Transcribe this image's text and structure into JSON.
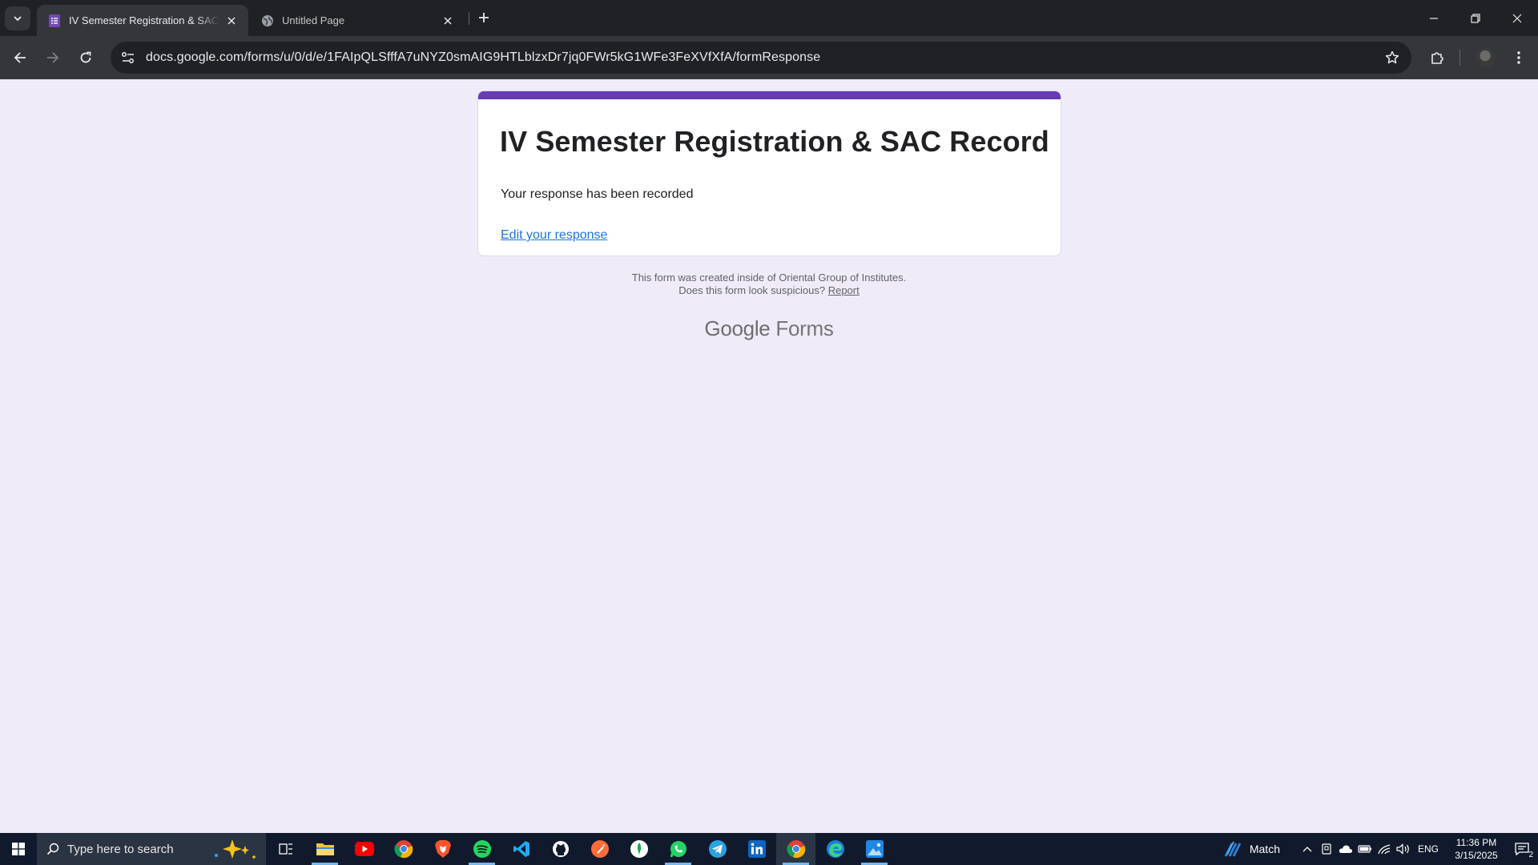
{
  "browser": {
    "tabs": [
      {
        "label": "IV Semester Registration & SAC Record",
        "active": true,
        "favicon": "google-forms-icon"
      },
      {
        "label": "Untitled Page",
        "active": false,
        "favicon": "globe-icon"
      }
    ],
    "url": "docs.google.com/forms/u/0/d/e/1FAIpQLSfffA7uNYZ0smAIG9HTLblzxDr7jq0FWr5kG1WFe3FeXVfXfA/formResponse"
  },
  "form": {
    "title": "IV Semester Registration & SAC Record",
    "confirmation": "Your response has been recorded",
    "edit_link": "Edit your response",
    "accent_color": "#673ab7"
  },
  "footer": {
    "created_inside": "This form was created inside of Oriental Group of Institutes.",
    "suspicious_prompt": "Does this form look suspicious?",
    "report_link": "Report",
    "brand_google": "Google",
    "brand_forms": "Forms"
  },
  "taskbar": {
    "search_placeholder": "Type here to search",
    "apps": [
      "task-view",
      "file-explorer",
      "youtube",
      "chrome",
      "brave",
      "spotify",
      "vscode",
      "github",
      "postman",
      "mongodb-compass",
      "whatsapp",
      "telegram",
      "linkedin",
      "chrome-active",
      "edge",
      "photos"
    ],
    "weather_label": "Match",
    "language": "ENG",
    "time": "11:36 PM",
    "date": "3/15/2025",
    "notification_count": "2"
  }
}
